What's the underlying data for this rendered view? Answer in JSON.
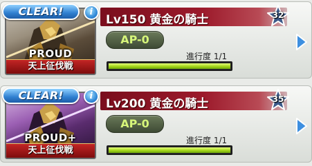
{
  "quests": [
    {
      "clear_label": "CLEAR!",
      "title": "Lv150 黄金の騎士",
      "tier": "PROUD",
      "category": "天上征伐戦",
      "star_number": "32",
      "ap_label": "AP-0",
      "progress_text": "進行度 1/1",
      "progress": 1.0
    },
    {
      "clear_label": "CLEAR!",
      "title": "Lv200 黄金の騎士",
      "tier": "PROUD+",
      "category": "天上征伐戦",
      "star_number": "35",
      "ap_label": "AP-0",
      "progress_text": "進行度 1/1",
      "progress": 1.0
    }
  ],
  "colors": {
    "title_bar": "#9c1a2b",
    "clear_badge": "#2f7fd0",
    "progress_fill": "#a4d61a",
    "ap_text": "#d6f57a"
  }
}
